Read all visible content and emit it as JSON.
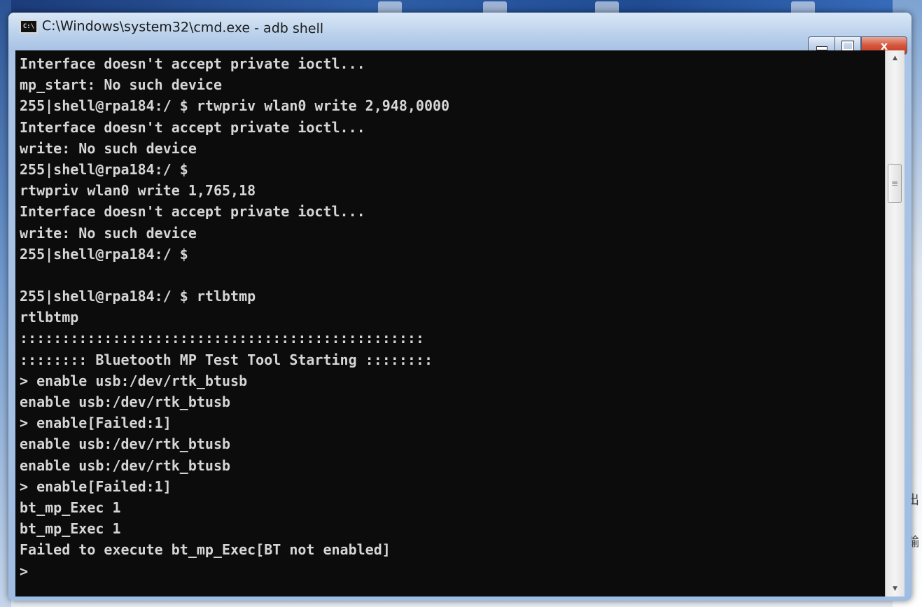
{
  "window": {
    "title": "C:\\Windows\\system32\\cmd.exe - adb shell",
    "icon_label": "C:\\",
    "controls": {
      "minimize_icon": "minimize-icon",
      "maximize_icon": "maximize-icon",
      "close_label": "x"
    }
  },
  "console": {
    "lines": [
      "Interface doesn't accept private ioctl...",
      "mp_start: No such device",
      "255|shell@rpa184:/ $ rtwpriv wlan0 write 2,948,0000",
      "Interface doesn't accept private ioctl...",
      "write: No such device",
      "255|shell@rpa184:/ $",
      "rtwpriv wlan0 write 1,765,18",
      "Interface doesn't accept private ioctl...",
      "write: No such device",
      "255|shell@rpa184:/ $",
      "",
      "255|shell@rpa184:/ $ rtlbtmp",
      "rtlbtmp",
      "::::::::::::::::::::::::::::::::::::::::::::::::",
      ":::::::: Bluetooth MP Test Tool Starting ::::::::",
      "> enable usb:/dev/rtk_btusb",
      "enable usb:/dev/rtk_btusb",
      "> enable[Failed:1]",
      "enable usb:/dev/rtk_btusb",
      "enable usb:/dev/rtk_btusb",
      "> enable[Failed:1]",
      "bt_mp_Exec 1",
      "bt_mp_Exec 1",
      "Failed to execute bt_mp_Exec[BT not enabled]",
      ">"
    ]
  },
  "scrollbar": {
    "up_icon": "scroll-up-arrow-icon",
    "down_icon": "scroll-down-arrow-icon",
    "thumb_grip": "≡"
  },
  "desktop_right_edge": {
    "glyphs": [
      "出",
      "輸"
    ]
  }
}
